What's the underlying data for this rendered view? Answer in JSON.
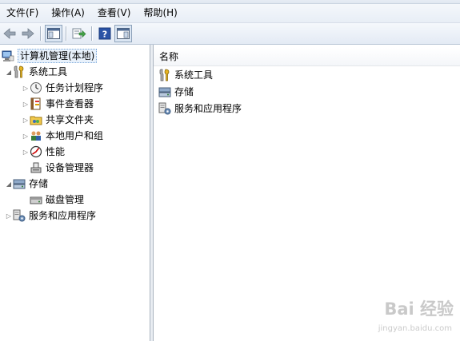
{
  "menu": {
    "items": [
      "文件(F)",
      "操作(A)",
      "查看(V)",
      "帮助(H)"
    ]
  },
  "toolbar": {
    "buttons": [
      "back-icon",
      "forward-icon",
      "show-hide-tree-icon",
      "export-list-icon",
      "help-icon",
      "show-hide-action-pane-icon"
    ]
  },
  "tree": {
    "root": {
      "label": "计算机管理(本地)",
      "icon": "computer-management-icon"
    },
    "system_tools": {
      "label": "系统工具",
      "icon": "tools-icon",
      "children": [
        {
          "label": "任务计划程序",
          "icon": "clock-icon"
        },
        {
          "label": "事件查看器",
          "icon": "event-viewer-icon"
        },
        {
          "label": "共享文件夹",
          "icon": "shared-folder-icon"
        },
        {
          "label": "本地用户和组",
          "icon": "users-icon"
        },
        {
          "label": "性能",
          "icon": "performance-icon"
        },
        {
          "label": "设备管理器",
          "icon": "device-manager-icon"
        }
      ]
    },
    "storage": {
      "label": "存储",
      "icon": "storage-icon",
      "children": [
        {
          "label": "磁盘管理",
          "icon": "disk-icon"
        }
      ]
    },
    "services": {
      "label": "服务和应用程序",
      "icon": "services-icon"
    }
  },
  "list": {
    "column_header": "名称",
    "items": [
      {
        "label": "系统工具",
        "icon": "tools-icon"
      },
      {
        "label": "存储",
        "icon": "storage-icon"
      },
      {
        "label": "服务和应用程序",
        "icon": "services-icon"
      }
    ]
  },
  "watermark": {
    "main": "Bai 经验",
    "sub": "jingyan.baidu.com"
  }
}
